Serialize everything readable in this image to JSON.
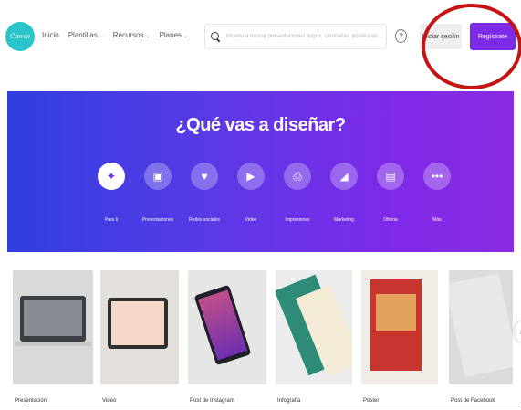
{
  "header": {
    "logo_text": "Canva",
    "nav": [
      {
        "label": "Inicio",
        "has_dropdown": false
      },
      {
        "label": "Plantillas",
        "has_dropdown": true
      },
      {
        "label": "Recursos",
        "has_dropdown": true
      },
      {
        "label": "Planes",
        "has_dropdown": true
      }
    ],
    "search_placeholder": "Prueba a buscar presentaciones, logos, camisetas, pósters en...",
    "help_label": "?",
    "login_label": "Iniciar sesión",
    "signup_label": "Regístrate"
  },
  "hero": {
    "title": "¿Qué vas a diseñar?",
    "categories": [
      {
        "label": "Para ti",
        "icon": "sparkle-icon",
        "glyph": "✦",
        "active": true
      },
      {
        "label": "Presentaciones",
        "icon": "presentation-icon",
        "glyph": "▣",
        "active": false
      },
      {
        "label": "Redes sociales",
        "icon": "heart-chat-icon",
        "glyph": "♥",
        "active": false
      },
      {
        "label": "Video",
        "icon": "play-icon",
        "glyph": "▶",
        "active": false
      },
      {
        "label": "Impresiones",
        "icon": "printer-icon",
        "glyph": "⎙",
        "active": false
      },
      {
        "label": "Marketing",
        "icon": "megaphone-icon",
        "glyph": "◢",
        "active": false
      },
      {
        "label": "Oficina",
        "icon": "briefcase-icon",
        "glyph": "▤",
        "active": false
      },
      {
        "label": "Más",
        "icon": "more-icon",
        "glyph": "•••",
        "active": false
      }
    ]
  },
  "thumbnails": [
    {
      "label": "Presentación"
    },
    {
      "label": "Video"
    },
    {
      "label": "Post de Instagram"
    },
    {
      "label": "Infografía"
    },
    {
      "label": "Póster"
    },
    {
      "label": "Post de Facebook"
    }
  ],
  "colors": {
    "brand_purple": "#7d2ae8",
    "logo_teal": "#2bc4c8",
    "annotation_red": "#c41414"
  }
}
